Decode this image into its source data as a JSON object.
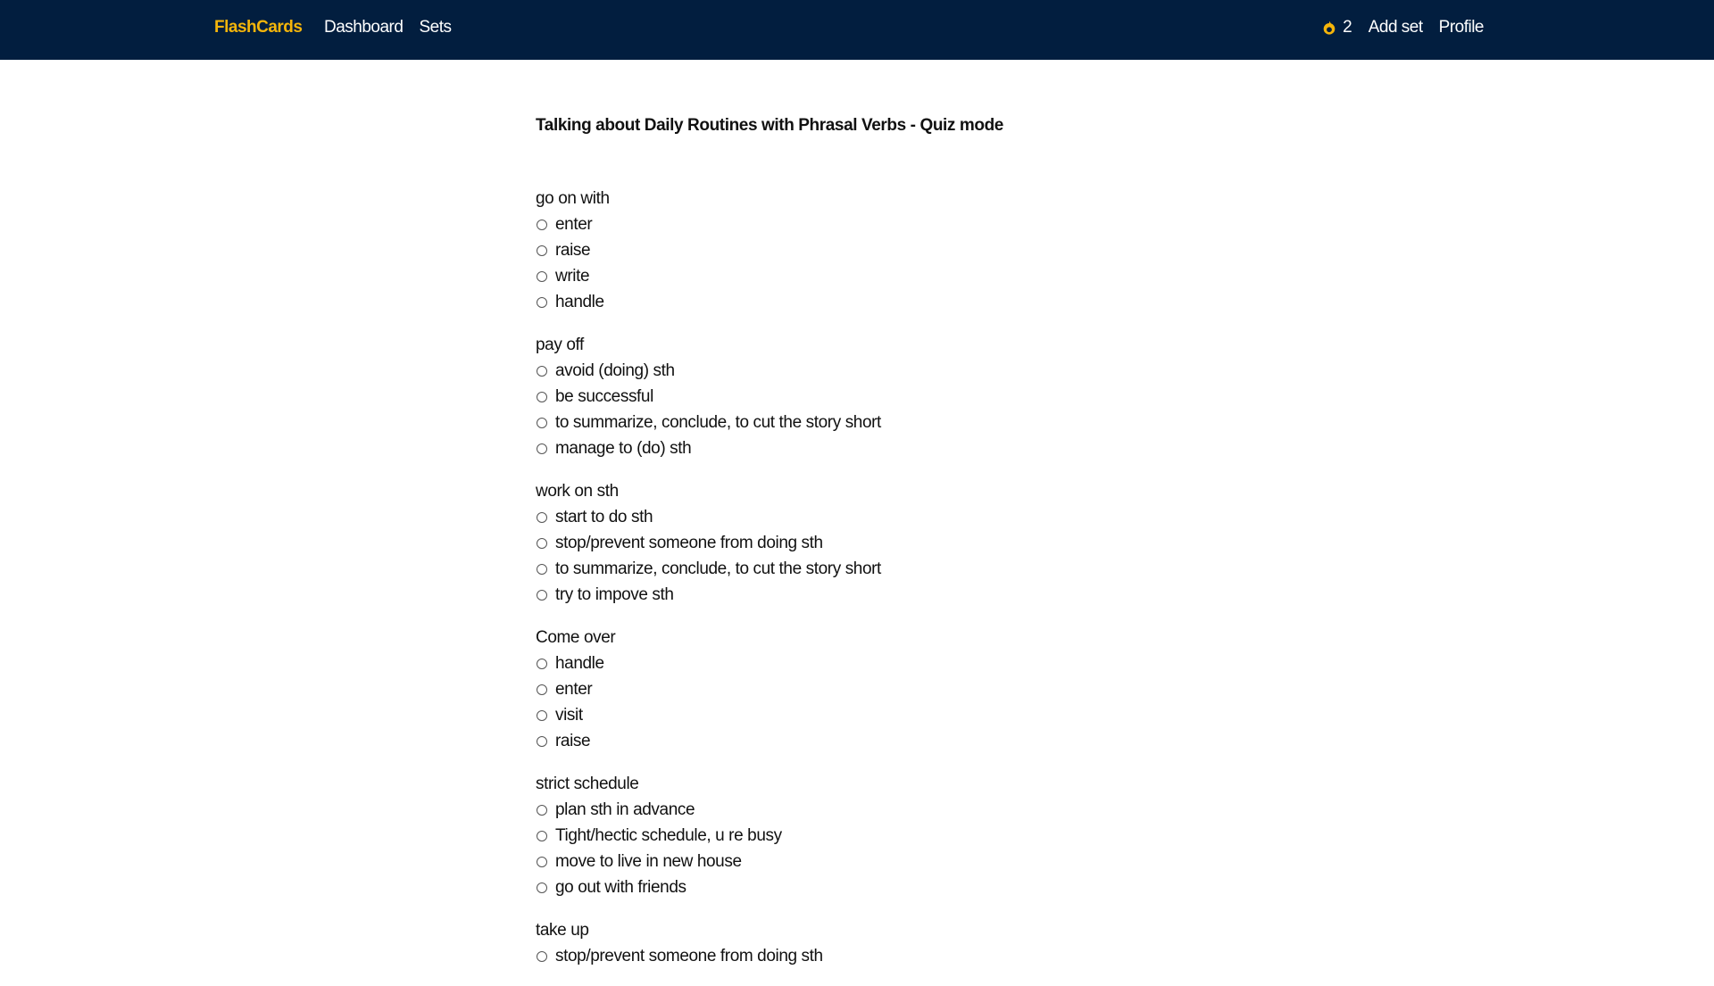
{
  "nav": {
    "brand": "FlashCards",
    "links": [
      "Dashboard",
      "Sets"
    ],
    "streak_count": "2",
    "add_set": "Add set",
    "profile": "Profile",
    "colors": {
      "background": "#021e3f",
      "brand": "#f5b50a",
      "link": "#ffffff"
    }
  },
  "quiz": {
    "title": "Talking about Daily Routines with Phrasal Verbs - Quiz mode",
    "questions": [
      {
        "term": "go on with",
        "options": [
          "enter",
          "raise",
          "write",
          "handle"
        ]
      },
      {
        "term": "pay off",
        "options": [
          "avoid (doing) sth",
          "be successful",
          "to summarize, conclude, to cut the story short",
          "manage to (do) sth"
        ]
      },
      {
        "term": "work on sth",
        "options": [
          "start to do sth",
          "stop/prevent someone from doing sth",
          "to summarize, conclude, to cut the story short",
          "try to impove sth"
        ]
      },
      {
        "term": "Come over",
        "options": [
          "handle",
          "enter",
          "visit",
          "raise"
        ]
      },
      {
        "term": "strict schedule",
        "options": [
          "plan sth in advance",
          "Tight/hectic schedule, u re busy",
          "move to live in new house",
          "go out with friends"
        ]
      },
      {
        "term": "take up",
        "options": [
          "stop/prevent someone from doing sth"
        ]
      }
    ]
  }
}
